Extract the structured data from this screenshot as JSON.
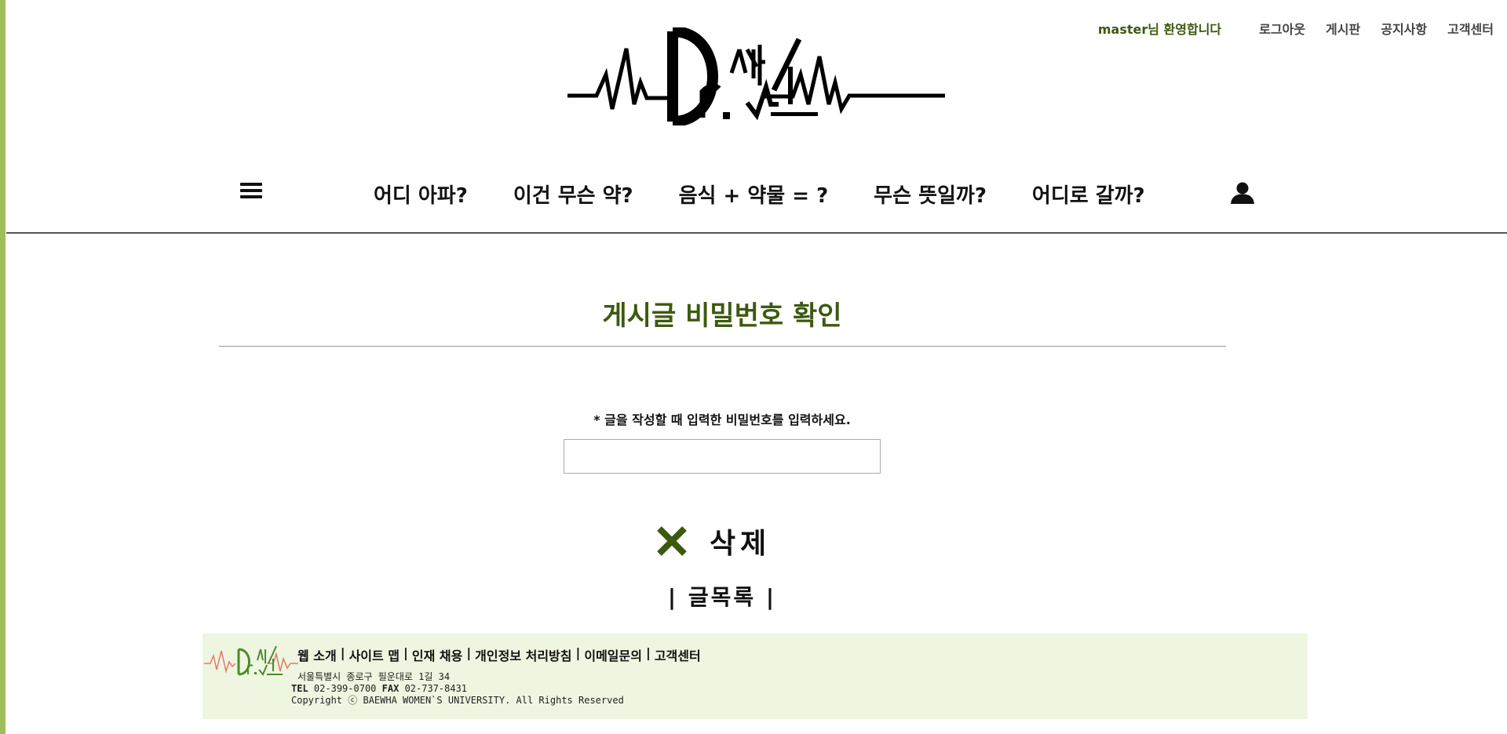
{
  "header": {
    "welcome": "master님 환영합니다",
    "links": [
      "로그아웃",
      "게시판",
      "공지사항",
      "고객센터"
    ]
  },
  "logo": {
    "text": "Dr.썰소"
  },
  "nav": {
    "items": [
      "어디 아파?",
      "이건 무슨 약?",
      "음식 + 약물 = ?",
      "무슨 뜻일까?",
      "어디로 갈까?"
    ]
  },
  "page": {
    "title": "게시글 비밀번호 확인",
    "instruction": "* 글을 작성할 때 입력한 비밀번호를 입력하세요.",
    "password_value": "",
    "delete_label": "삭제",
    "list_label": "| 글목록 |"
  },
  "footer": {
    "links": [
      "웹 소개",
      "사이트 맵",
      "인재 채용",
      "개인정보 처리방침",
      "이메일문의",
      "고객센터"
    ],
    "address": "서울특별시 종로구 필운대로 1길 34",
    "tel_label": "TEL",
    "tel": "02-399-0700",
    "fax_label": "FAX",
    "fax": "02-737-8431",
    "copyright": "Copyright ⓒ BAEWHA WOMEN`S UNIVERSITY. All Rights Reserved"
  },
  "colors": {
    "accent": "#3c5a0f",
    "sidebar": "#9fbd5a",
    "footer_bg": "#eef5e0"
  }
}
